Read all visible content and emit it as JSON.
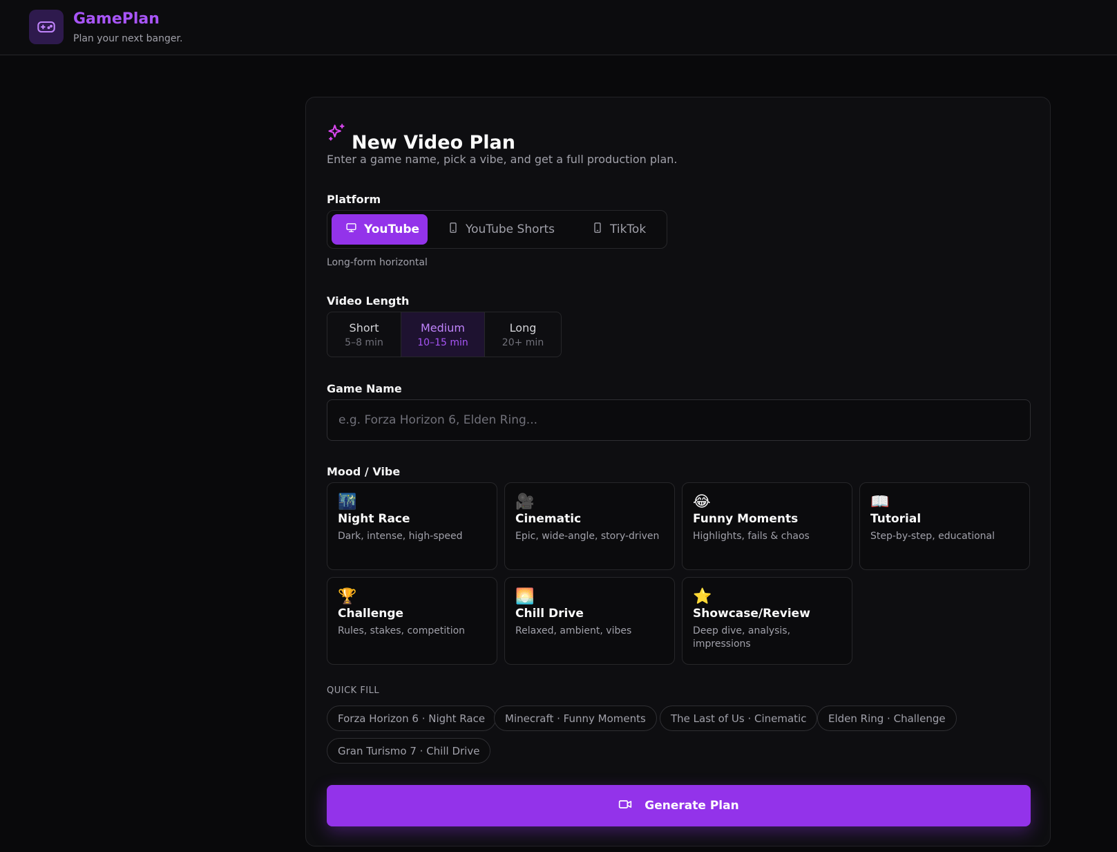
{
  "app": {
    "name": "GamePlan",
    "tagline": "Plan your next banger.",
    "logo_icon": "gamepad-icon"
  },
  "form": {
    "title": "New Video Plan",
    "title_icon": "sparkles-icon",
    "subtitle": "Enter a game name, pick a vibe, and get a full production plan.",
    "platform": {
      "label": "Platform",
      "options": [
        {
          "label": "YouTube",
          "icon": "monitor-icon",
          "selected": true
        },
        {
          "label": "YouTube Shorts",
          "icon": "smartphone-icon",
          "selected": false
        },
        {
          "label": "TikTok",
          "icon": "smartphone-icon",
          "selected": false
        }
      ],
      "hint": "Long-form horizontal"
    },
    "length": {
      "label": "Video Length",
      "options": [
        {
          "label": "Short",
          "range": "5–8 min",
          "selected": false
        },
        {
          "label": "Medium",
          "range": "10–15 min",
          "selected": true
        },
        {
          "label": "Long",
          "range": "20+ min",
          "selected": false
        }
      ]
    },
    "game": {
      "label": "Game Name",
      "value": "",
      "placeholder": "e.g. Forza Horizon 6, Elden Ring..."
    },
    "mood": {
      "label": "Mood / Vibe",
      "options": [
        {
          "emoji": "🌃",
          "title": "Night Race",
          "desc": "Dark, intense, high-speed"
        },
        {
          "emoji": "🎥",
          "title": "Cinematic",
          "desc": "Epic, wide-angle, story-driven"
        },
        {
          "emoji": "😂",
          "title": "Funny Moments",
          "desc": "Highlights, fails & chaos"
        },
        {
          "emoji": "📖",
          "title": "Tutorial",
          "desc": "Step-by-step, educational"
        },
        {
          "emoji": "🏆",
          "title": "Challenge",
          "desc": "Rules, stakes, competition"
        },
        {
          "emoji": "🌅",
          "title": "Chill Drive",
          "desc": "Relaxed, ambient, vibes"
        },
        {
          "emoji": "⭐",
          "title": "Showcase/Review",
          "desc": "Deep dive, analysis, impressions"
        }
      ]
    },
    "quick_fill": {
      "label": "QUICK FILL",
      "items": [
        "Forza Horizon 6 · Night Race",
        "Minecraft · Funny Moments",
        "The Last of Us · Cinematic",
        "Elden Ring · Challenge",
        "Gran Turismo 7 · Chill Drive"
      ]
    },
    "submit": {
      "label": "Generate Plan",
      "icon": "video-camera-icon"
    }
  },
  "colors": {
    "accent": "#9333ea",
    "accent_text": "#a855f7",
    "background": "#09090b",
    "card": "#0e0e11"
  }
}
